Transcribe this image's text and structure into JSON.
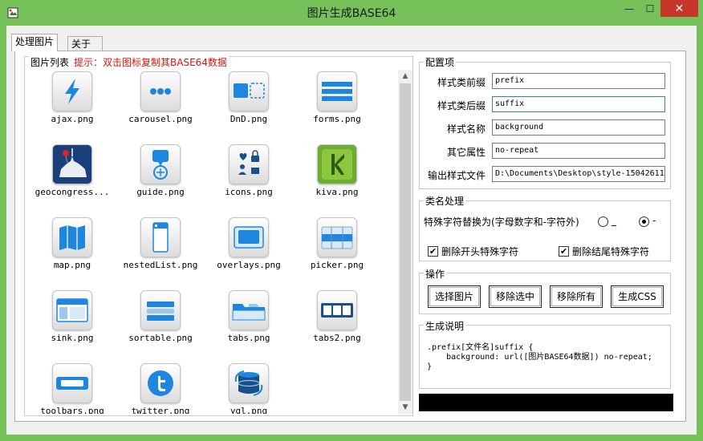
{
  "window": {
    "title": "图片生成BASE64",
    "min_glyph": "—",
    "max_glyph": "☐",
    "close_glyph": "✕"
  },
  "tabs": [
    {
      "label": "处理图片"
    },
    {
      "label": "关于"
    }
  ],
  "image_list": {
    "legend": "图片列表",
    "hint": "提示：双击图标复制其BASE64数据",
    "items": [
      {
        "label": "ajax.png",
        "icon": "lightning-icon"
      },
      {
        "label": "carousel.png",
        "icon": "dots-icon"
      },
      {
        "label": "DnD.png",
        "icon": "drag-drop-icon"
      },
      {
        "label": "forms.png",
        "icon": "form-lines-icon"
      },
      {
        "label": "geocongress...",
        "icon": "capitol-map-icon"
      },
      {
        "label": "guide.png",
        "icon": "guide-icon"
      },
      {
        "label": "icons.png",
        "icon": "icon-grid-icon"
      },
      {
        "label": "kiva.png",
        "icon": "kiva-logo-icon"
      },
      {
        "label": "map.png",
        "icon": "folded-map-icon"
      },
      {
        "label": "nestedList.png",
        "icon": "nested-list-icon"
      },
      {
        "label": "overlays.png",
        "icon": "overlay-icon"
      },
      {
        "label": "picker.png",
        "icon": "picker-icon"
      },
      {
        "label": "sink.png",
        "icon": "window-icon"
      },
      {
        "label": "sortable.png",
        "icon": "sortable-icon"
      },
      {
        "label": "tabs.png",
        "icon": "folder-tab-icon"
      },
      {
        "label": "tabs2.png",
        "icon": "tabs-icon"
      },
      {
        "label": "toolbars.png",
        "icon": "toolbar-icon"
      },
      {
        "label": "twitter.png",
        "icon": "twitter-bird-icon"
      },
      {
        "label": "yql.png",
        "icon": "database-sync-icon"
      }
    ],
    "scroll_up": "▲",
    "scroll_down": "▼"
  },
  "config": {
    "legend": "配置项",
    "fields": [
      {
        "label": "样式类前缀",
        "value": "prefix"
      },
      {
        "label": "样式类后缀",
        "value": "suffix"
      },
      {
        "label": "样式名称",
        "value": "background"
      },
      {
        "label": "其它属性",
        "value": "no-repeat"
      },
      {
        "label": "输出样式文件",
        "value": "D:\\Documents\\Desktop\\style-15042611"
      }
    ]
  },
  "class_processing": {
    "legend": "类名处理",
    "replace_label": "特殊字符替换为(字母数字和-字符外)",
    "option_underscore": "_",
    "option_dash": "-",
    "selected": "-",
    "remove_leading_label": "删除开头特殊字符",
    "remove_leading_checked": true,
    "remove_trailing_label": "删除结尾特殊字符",
    "remove_trailing_checked": true,
    "check_glyph": "✔"
  },
  "operations": {
    "legend": "操作",
    "select_images": "选择图片",
    "remove_selected": "移除选中",
    "remove_all": "移除所有",
    "generate_css": "生成CSS"
  },
  "description": {
    "legend": "生成说明",
    "text": ".prefix[文件名]suffix {\n    background: url([图片BASE64数据]) no-repeat;\n}"
  },
  "colors": {
    "frame": "#76c15a",
    "hint_red": "#d8150f",
    "icon_blue": "#1f86e0",
    "close_red": "#c7362b"
  }
}
